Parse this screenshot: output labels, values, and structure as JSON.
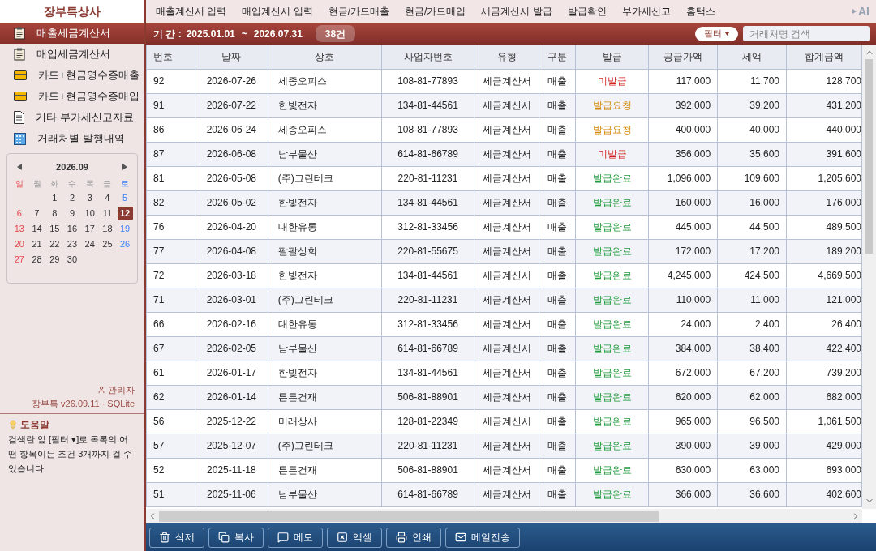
{
  "app_title": "장부특상사",
  "menu": [
    "매출계산서 입력",
    "매입계산서 입력",
    "현금/카드매출",
    "현금/카드매입",
    "세금계산서 발급",
    "발급확인",
    "부가세신고",
    "홈택스"
  ],
  "ai_label": "AI",
  "sidebar": {
    "items": [
      {
        "label": "매출세금계산서",
        "kind": "clipboard",
        "selected": true
      },
      {
        "label": "매입세금계산서",
        "kind": "clipboard",
        "selected": false
      },
      {
        "label": "카드+현금영수증매출",
        "kind": "card",
        "selected": false
      },
      {
        "label": "카드+현금영수증매입",
        "kind": "card",
        "selected": false
      },
      {
        "label": "기타 부가세신고자료",
        "kind": "document",
        "selected": false
      },
      {
        "label": "거래처별 발행내역",
        "kind": "building",
        "selected": false
      }
    ]
  },
  "calendar": {
    "month": "2026.09",
    "weekdays": [
      "일",
      "월",
      "화",
      "수",
      "목",
      "금",
      "토"
    ],
    "weeks": [
      {
        "days": [
          {
            "day": "1",
            "selected": false
          },
          {
            "day": "2",
            "selected": false
          },
          {
            "day": "3",
            "selected": false
          },
          {
            "day": "4",
            "selected": false
          },
          {
            "day": "5",
            "selected": false
          }
        ]
      },
      {
        "days": [
          {
            "day": "6",
            "selected": false
          },
          {
            "day": "7",
            "selected": false
          },
          {
            "day": "8",
            "selected": false
          },
          {
            "day": "9",
            "selected": false
          },
          {
            "day": "10",
            "selected": false
          },
          {
            "day": "11",
            "selected": false
          },
          {
            "day": "12",
            "selected": true
          }
        ]
      },
      {
        "days": [
          {
            "day": "13",
            "selected": false
          },
          {
            "day": "14",
            "selected": false
          },
          {
            "day": "15",
            "selected": false
          },
          {
            "day": "16",
            "selected": false
          },
          {
            "day": "17",
            "selected": false
          },
          {
            "day": "18",
            "selected": false
          },
          {
            "day": "19",
            "selected": false
          }
        ]
      },
      {
        "days": [
          {
            "day": "20",
            "selected": false
          },
          {
            "day": "21",
            "selected": false
          },
          {
            "day": "22",
            "selected": false
          },
          {
            "day": "23",
            "selected": false
          },
          {
            "day": "24",
            "selected": false
          },
          {
            "day": "25",
            "selected": false
          },
          {
            "day": "26",
            "selected": false
          }
        ]
      },
      {
        "days": [
          {
            "day": "27",
            "selected": false
          },
          {
            "day": "28",
            "selected": false
          },
          {
            "day": "29",
            "selected": false
          },
          {
            "day": "30",
            "selected": false
          }
        ]
      }
    ]
  },
  "user": "관리자",
  "version": "장부톡 v26.09.11 · SQLite",
  "help": {
    "title": "도움말",
    "text": "검색란 앞 [필터 ▾]로 목록의 어떤 항목이든 조건 3개까지 걸 수 있습니다."
  },
  "toolbar": {
    "period_label": "기 간 :",
    "period_from": "2025.01.01",
    "period_sep": "~",
    "period_to": "2026.07.31",
    "count": "38건",
    "filter_button": "필터",
    "search": {
      "placeholder": "거래처명 검색"
    }
  },
  "table": {
    "columns": [
      "번호",
      "날짜",
      "상호",
      "사업자번호",
      "유형",
      "구분",
      "발급",
      "공급가액",
      "세액",
      "합계금액"
    ],
    "rows": [
      {
        "cells": [
          "92",
          "2026-07-26",
          "세종오피스",
          "108-81-77893",
          "세금계산서",
          "매출",
          "미발급",
          "117,000",
          "11,700",
          "128,700"
        ],
        "color": "#d42020"
      },
      {
        "cells": [
          "91",
          "2026-07-22",
          "한빛전자",
          "134-81-44561",
          "세금계산서",
          "매출",
          "발급요청",
          "392,000",
          "39,200",
          "431,200"
        ],
        "color": "#d48806"
      },
      {
        "cells": [
          "86",
          "2026-06-24",
          "세종오피스",
          "108-81-77893",
          "세금계산서",
          "매출",
          "발급요청",
          "400,000",
          "40,000",
          "440,000"
        ],
        "color": "#d48806"
      },
      {
        "cells": [
          "87",
          "2026-06-08",
          "남부물산",
          "614-81-66789",
          "세금계산서",
          "매출",
          "미발급",
          "356,000",
          "35,600",
          "391,600"
        ],
        "color": "#d42020"
      },
      {
        "cells": [
          "81",
          "2026-05-08",
          "(주)그린테크",
          "220-81-11231",
          "세금계산서",
          "매출",
          "발급완료",
          "1,096,000",
          "109,600",
          "1,205,600"
        ],
        "color": "#1f9a3a"
      },
      {
        "cells": [
          "82",
          "2026-05-02",
          "한빛전자",
          "134-81-44561",
          "세금계산서",
          "매출",
          "발급완료",
          "160,000",
          "16,000",
          "176,000"
        ],
        "color": "#1f9a3a"
      },
      {
        "cells": [
          "76",
          "2026-04-20",
          "대한유통",
          "312-81-33456",
          "세금계산서",
          "매출",
          "발급완료",
          "445,000",
          "44,500",
          "489,500"
        ],
        "color": "#1f9a3a"
      },
      {
        "cells": [
          "77",
          "2026-04-08",
          "팔팔상회",
          "220-81-55675",
          "세금계산서",
          "매출",
          "발급완료",
          "172,000",
          "17,200",
          "189,200"
        ],
        "color": "#1f9a3a"
      },
      {
        "cells": [
          "72",
          "2026-03-18",
          "한빛전자",
          "134-81-44561",
          "세금계산서",
          "매출",
          "발급완료",
          "4,245,000",
          "424,500",
          "4,669,500"
        ],
        "color": "#1f9a3a"
      },
      {
        "cells": [
          "71",
          "2026-03-01",
          "(주)그린테크",
          "220-81-11231",
          "세금계산서",
          "매출",
          "발급완료",
          "110,000",
          "11,000",
          "121,000"
        ],
        "color": "#1f9a3a"
      },
      {
        "cells": [
          "66",
          "2026-02-16",
          "대한유통",
          "312-81-33456",
          "세금계산서",
          "매출",
          "발급완료",
          "24,000",
          "2,400",
          "26,400"
        ],
        "color": "#1f9a3a"
      },
      {
        "cells": [
          "67",
          "2026-02-05",
          "남부물산",
          "614-81-66789",
          "세금계산서",
          "매출",
          "발급완료",
          "384,000",
          "38,400",
          "422,400"
        ],
        "color": "#1f9a3a"
      },
      {
        "cells": [
          "61",
          "2026-01-17",
          "한빛전자",
          "134-81-44561",
          "세금계산서",
          "매출",
          "발급완료",
          "672,000",
          "67,200",
          "739,200"
        ],
        "color": "#1f9a3a"
      },
      {
        "cells": [
          "62",
          "2026-01-14",
          "튼튼건재",
          "506-81-88901",
          "세금계산서",
          "매출",
          "발급완료",
          "620,000",
          "62,000",
          "682,000"
        ],
        "color": "#1f9a3a"
      },
      {
        "cells": [
          "56",
          "2025-12-22",
          "미래상사",
          "128-81-22349",
          "세금계산서",
          "매출",
          "발급완료",
          "965,000",
          "96,500",
          "1,061,500"
        ],
        "color": "#1f9a3a"
      },
      {
        "cells": [
          "57",
          "2025-12-07",
          "(주)그린테크",
          "220-81-11231",
          "세금계산서",
          "매출",
          "발급완료",
          "390,000",
          "39,000",
          "429,000"
        ],
        "color": "#1f9a3a"
      },
      {
        "cells": [
          "52",
          "2025-11-18",
          "튼튼건재",
          "506-81-88901",
          "세금계산서",
          "매출",
          "발급완료",
          "630,000",
          "63,000",
          "693,000"
        ],
        "color": "#1f9a3a"
      },
      {
        "cells": [
          "51",
          "2025-11-06",
          "남부물산",
          "614-81-66789",
          "세금계산서",
          "매출",
          "발급완료",
          "366,000",
          "36,600",
          "402,600"
        ],
        "color": "#1f9a3a"
      }
    ]
  },
  "actions": [
    {
      "label": "삭제",
      "kind": "trash"
    },
    {
      "label": "복사",
      "kind": "copy"
    },
    {
      "label": "메모",
      "kind": "memo"
    },
    {
      "label": "엑셀",
      "kind": "excel"
    },
    {
      "label": "인쇄",
      "kind": "print"
    },
    {
      "label": "메일전송",
      "kind": "mail"
    }
  ]
}
